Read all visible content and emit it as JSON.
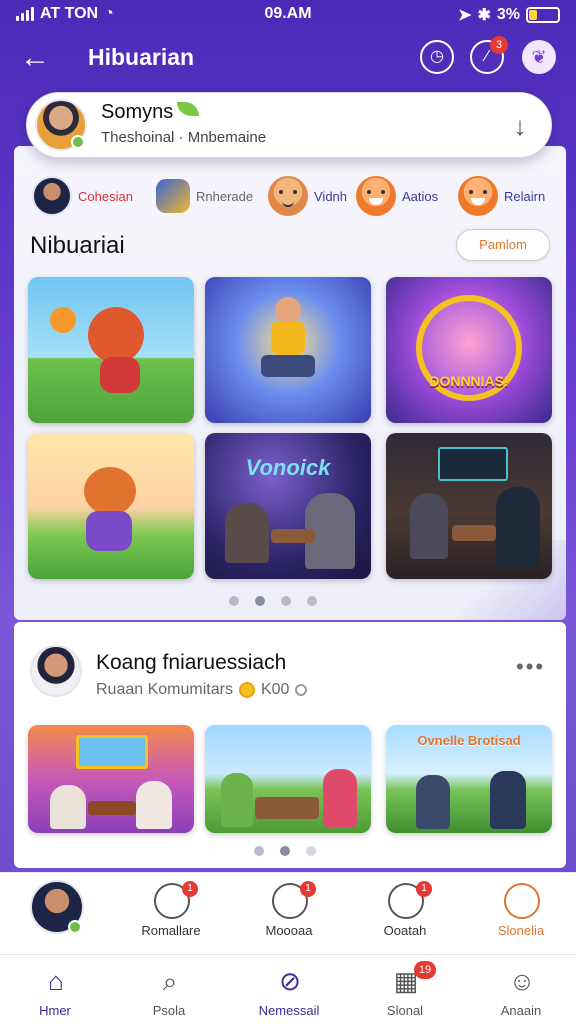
{
  "status_bar": {
    "carrier": "AT TON",
    "time": "09.AM",
    "battery": "3%"
  },
  "header": {
    "title": "Hibuarian",
    "notification_count": "3"
  },
  "profile": {
    "name": "Somyns",
    "subtitle": "Theshoinal · Mnbemaine"
  },
  "categories": [
    {
      "label": "Cohesian"
    },
    {
      "label": "Rnherade"
    },
    {
      "label": "Vidnh"
    },
    {
      "label": "Aatios"
    },
    {
      "label": "Relairn"
    }
  ],
  "section": {
    "title": "Nibuariai",
    "button": "Pamlom"
  },
  "tiles": [
    {
      "caption": ""
    },
    {
      "caption": ""
    },
    {
      "caption": "DONNNIAS!"
    },
    {
      "caption": ""
    },
    {
      "caption": "Vonoick"
    },
    {
      "caption": ""
    }
  ],
  "feed": {
    "name": "Koang fniaruessiach",
    "subtitle": "Ruaan Komumitars",
    "coins": "K00",
    "tiles": [
      {
        "caption": ""
      },
      {
        "caption": ""
      },
      {
        "caption": "Ovnelle Brotisad"
      }
    ]
  },
  "quick_actions": [
    {
      "label": "Romallare",
      "badge": "1",
      "icon": "chef-icon"
    },
    {
      "label": "Moooaa",
      "badge": "1",
      "icon": "face-icon"
    },
    {
      "label": "Ooatah",
      "badge": "1",
      "icon": "pencil-icon"
    },
    {
      "label": "Slonelia",
      "icon": "search-icon",
      "color": "#e0762e"
    }
  ],
  "nav": [
    {
      "label": "Hmer",
      "icon": "home-icon"
    },
    {
      "label": "Psola",
      "icon": "search-icon"
    },
    {
      "label": "Nemessail",
      "icon": "compass-icon"
    },
    {
      "label": "Slonal",
      "badge": "19",
      "icon": "chart-icon"
    },
    {
      "label": "Anaain",
      "icon": "user-icon"
    }
  ],
  "colors": {
    "accent": "#5a33c8",
    "orange": "#e0762e",
    "badge": "#e53935"
  }
}
